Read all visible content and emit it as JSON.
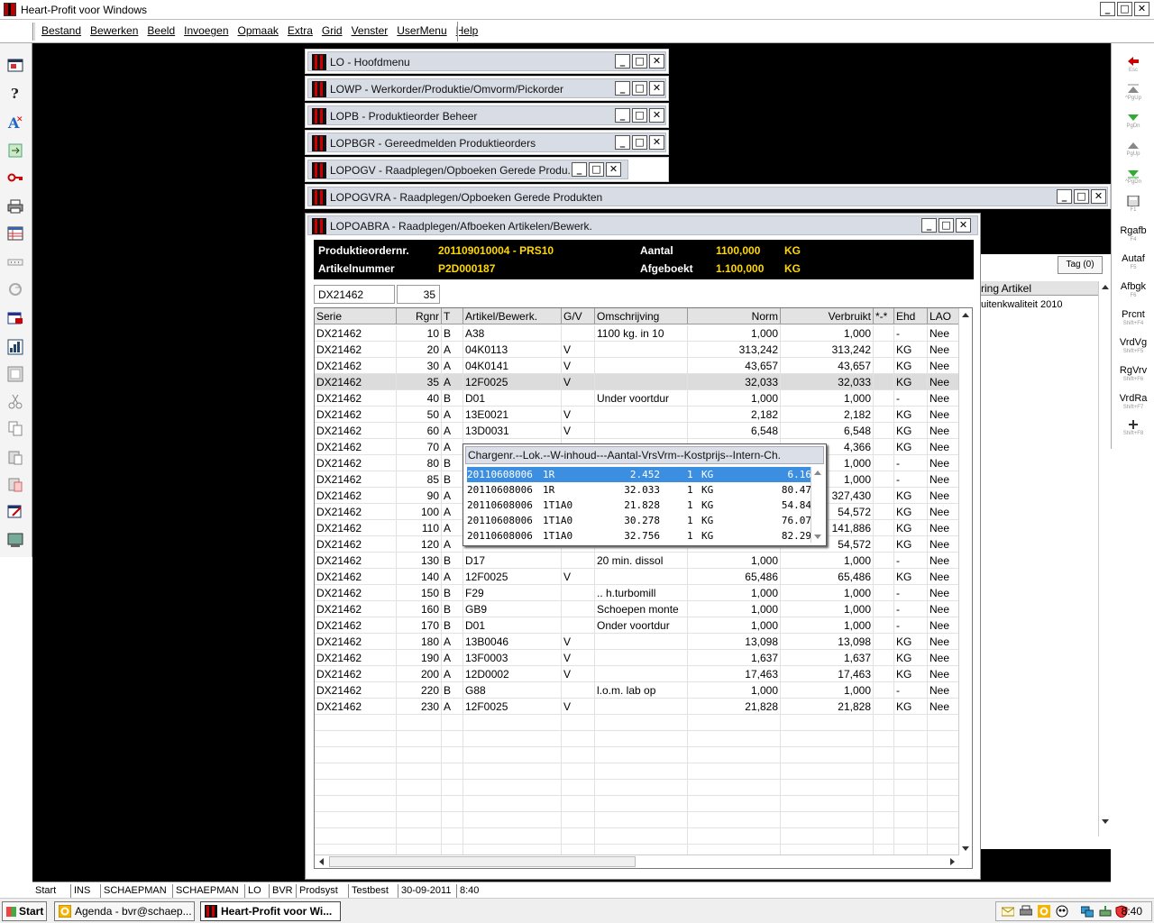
{
  "app": {
    "title": "Heart-Profit voor Windows",
    "min_glyph": "_",
    "max_glyph": "□",
    "close_glyph": "✕"
  },
  "menu": [
    "Bestand",
    "Bewerken",
    "Beeld",
    "Invoegen",
    "Opmaak",
    "Extra",
    "Grid",
    "Venster",
    "UserMenu",
    "Help"
  ],
  "left_toolbar_icons": [
    "window-icon",
    "help-icon",
    "font-delete-icon",
    "export-icon",
    "key-icon",
    "printer-icon",
    "table-icon",
    "dots-icon",
    "refresh-icon",
    "delete-record-icon",
    "chart-icon",
    "frame-icon",
    "cut-icon",
    "copy-icon",
    "paste-icon",
    "paste-special-icon",
    "edit-icon",
    "monitor-icon"
  ],
  "right_toolbar": [
    {
      "label": "",
      "sub": "Esc",
      "icon": "arrow-left-icon"
    },
    {
      "label": "",
      "sub": "^PgUp",
      "icon": "arrow-first-icon"
    },
    {
      "label": "",
      "sub": "PgDn",
      "icon": "arrow-down-icon"
    },
    {
      "label": "",
      "sub": "PgUp",
      "icon": "arrow-up-icon"
    },
    {
      "label": "",
      "sub": "^PgDn",
      "icon": "arrow-last-icon"
    },
    {
      "label": "",
      "sub": "F1",
      "icon": "calculator-icon"
    },
    {
      "label": "Rgafb",
      "sub": "F4",
      "icon": ""
    },
    {
      "label": "Autaf",
      "sub": "F5",
      "icon": ""
    },
    {
      "label": "Afbgk",
      "sub": "F6",
      "icon": ""
    },
    {
      "label": "Prcnt",
      "sub": "Shift+F4",
      "icon": ""
    },
    {
      "label": "VrdVg",
      "sub": "Shift+F5",
      "icon": ""
    },
    {
      "label": "RgVrv",
      "sub": "Shift+F6",
      "icon": ""
    },
    {
      "label": "VrdRa",
      "sub": "Shift+F7",
      "icon": ""
    },
    {
      "label": "",
      "sub": "Shift+F8",
      "icon": "plus-icon"
    }
  ],
  "bg_windows": [
    {
      "title": "LO - Hoofdmenu"
    },
    {
      "title": "LOWP - Werkorder/Produktie/Omvorm/Pickorder"
    },
    {
      "title": "LOPB - Produktieorder Beheer"
    },
    {
      "title": "LOPBGR - Gereedmelden Produktieorders"
    },
    {
      "title": "LOPOGV - Raadplegen/Opboeken Gerede Produ..."
    },
    {
      "title": "LOPOGVRA - Raadplegen/Opboeken Gerede Produkten"
    }
  ],
  "bg_pane": {
    "tag_button": "Tag (0)",
    "header": "ring Artikel",
    "row": "uitenkwaliteit 2010"
  },
  "main_window": {
    "title": "LOPOABRA - Raadplegen/Afboeken Artikelen/Bewerk.",
    "info": {
      "prod_label": "Produktieordernr.",
      "prod_value": "201109010004 - PRS10",
      "art_label": "Artikelnummer",
      "art_value": "P2D000187",
      "aantal_label": "Aantal",
      "aantal_value": "1100,000",
      "aantal_unit": "KG",
      "afgeboekt_label": "Afgeboekt",
      "afgeboekt_value": "1.100,000",
      "afgeboekt_unit": "KG"
    },
    "search_serie": "DX21462",
    "search_rgnr": "35",
    "columns": [
      "Serie",
      "Rgnr",
      "T",
      "Artikel/Bewerk.",
      "G/V",
      "Omschrijving",
      "Norm",
      "Verbruikt",
      "*-*",
      "Ehd",
      "LAO"
    ],
    "rows": [
      [
        "DX21462",
        "10",
        "B",
        "A38",
        "",
        "1100 kg. in 10",
        "1,000",
        "1,000",
        "",
        "-",
        "Nee"
      ],
      [
        "DX21462",
        "20",
        "A",
        "04K0113",
        "V",
        "",
        "313,242",
        "313,242",
        "",
        "KG",
        "Nee"
      ],
      [
        "DX21462",
        "30",
        "A",
        "04K0141",
        "V",
        "",
        "43,657",
        "43,657",
        "",
        "KG",
        "Nee"
      ],
      [
        "DX21462",
        "35",
        "A",
        "12F0025",
        "V",
        "",
        "32,033",
        "32,033",
        "",
        "KG",
        "Nee"
      ],
      [
        "DX21462",
        "40",
        "B",
        "D01",
        "",
        "Under voortdur",
        "1,000",
        "1,000",
        "",
        "-",
        "Nee"
      ],
      [
        "DX21462",
        "50",
        "A",
        "13E0021",
        "V",
        "",
        "2,182",
        "2,182",
        "",
        "KG",
        "Nee"
      ],
      [
        "DX21462",
        "60",
        "A",
        "13D0031",
        "V",
        "",
        "6,548",
        "6,548",
        "",
        "KG",
        "Nee"
      ],
      [
        "DX21462",
        "70",
        "A",
        "",
        "",
        "",
        "",
        "4,366",
        "",
        "KG",
        "Nee"
      ],
      [
        "DX21462",
        "80",
        "B",
        "",
        "",
        "",
        "",
        "1,000",
        "",
        "-",
        "Nee"
      ],
      [
        "DX21462",
        "85",
        "B",
        "",
        "",
        "",
        "",
        "1,000",
        "",
        "-",
        "Nee"
      ],
      [
        "DX21462",
        "90",
        "A",
        "",
        "",
        "",
        "",
        "327,430",
        "",
        "KG",
        "Nee"
      ],
      [
        "DX21462",
        "100",
        "A",
        "",
        "",
        "",
        "",
        "54,572",
        "",
        "KG",
        "Nee"
      ],
      [
        "DX21462",
        "110",
        "A",
        "",
        "",
        "",
        "",
        "141,886",
        "",
        "KG",
        "Nee"
      ],
      [
        "DX21462",
        "120",
        "A",
        "",
        "",
        "",
        "",
        "54,572",
        "",
        "KG",
        "Nee"
      ],
      [
        "DX21462",
        "130",
        "B",
        "D17",
        "",
        "20 min. dissol",
        "1,000",
        "1,000",
        "",
        "-",
        "Nee"
      ],
      [
        "DX21462",
        "140",
        "A",
        "12F0025",
        "V",
        "",
        "65,486",
        "65,486",
        "",
        "KG",
        "Nee"
      ],
      [
        "DX21462",
        "150",
        "B",
        "F29",
        "",
        ".. h.turbomill",
        "1,000",
        "1,000",
        "",
        "-",
        "Nee"
      ],
      [
        "DX21462",
        "160",
        "B",
        "GB9",
        "",
        "Schoepen monte",
        "1,000",
        "1,000",
        "",
        "-",
        "Nee"
      ],
      [
        "DX21462",
        "170",
        "B",
        "D01",
        "",
        "Onder voortdur",
        "1,000",
        "1,000",
        "",
        "-",
        "Nee"
      ],
      [
        "DX21462",
        "180",
        "A",
        "13B0046",
        "V",
        "",
        "13,098",
        "13,098",
        "",
        "KG",
        "Nee"
      ],
      [
        "DX21462",
        "190",
        "A",
        "13F0003",
        "V",
        "",
        "1,637",
        "1,637",
        "",
        "KG",
        "Nee"
      ],
      [
        "DX21462",
        "200",
        "A",
        "12D0002",
        "V",
        "",
        "17,463",
        "17,463",
        "",
        "KG",
        "Nee"
      ],
      [
        "DX21462",
        "220",
        "B",
        "G88",
        "",
        "l.o.m. lab op",
        "1,000",
        "1,000",
        "",
        "-",
        "Nee"
      ],
      [
        "DX21462",
        "230",
        "A",
        "12F0025",
        "V",
        "",
        "21,828",
        "21,828",
        "",
        "KG",
        "Nee"
      ]
    ]
  },
  "popup": {
    "header": "Chargenr.--Lok.--W-inhoud---Aantal-VrsVrm--Kostprijs--Intern-Ch.",
    "rows": [
      [
        "20110608006",
        "1R",
        "2.452",
        "1",
        "KG",
        "6.16"
      ],
      [
        "20110608006",
        "1R",
        "32.033",
        "1",
        "KG",
        "80.47"
      ],
      [
        "20110608006",
        "1T1A0",
        "21.828",
        "1",
        "KG",
        "54.84"
      ],
      [
        "20110608006",
        "1T1A0",
        "30.278",
        "1",
        "KG",
        "76.07"
      ],
      [
        "20110608006",
        "1T1A0",
        "32.756",
        "1",
        "KG",
        "82.29"
      ]
    ]
  },
  "statusbar": [
    "Start",
    "INS",
    "SCHAEPMAN",
    "SCHAEPMAN",
    "LO",
    "BVR",
    "Prodsyst",
    "Testbest",
    "30-09-2011",
    "8:40"
  ],
  "taskbar": {
    "start": "Start",
    "tasks": [
      "Agenda - bvr@schaep...",
      "Heart-Profit voor Wi..."
    ],
    "clock": "8:40"
  }
}
